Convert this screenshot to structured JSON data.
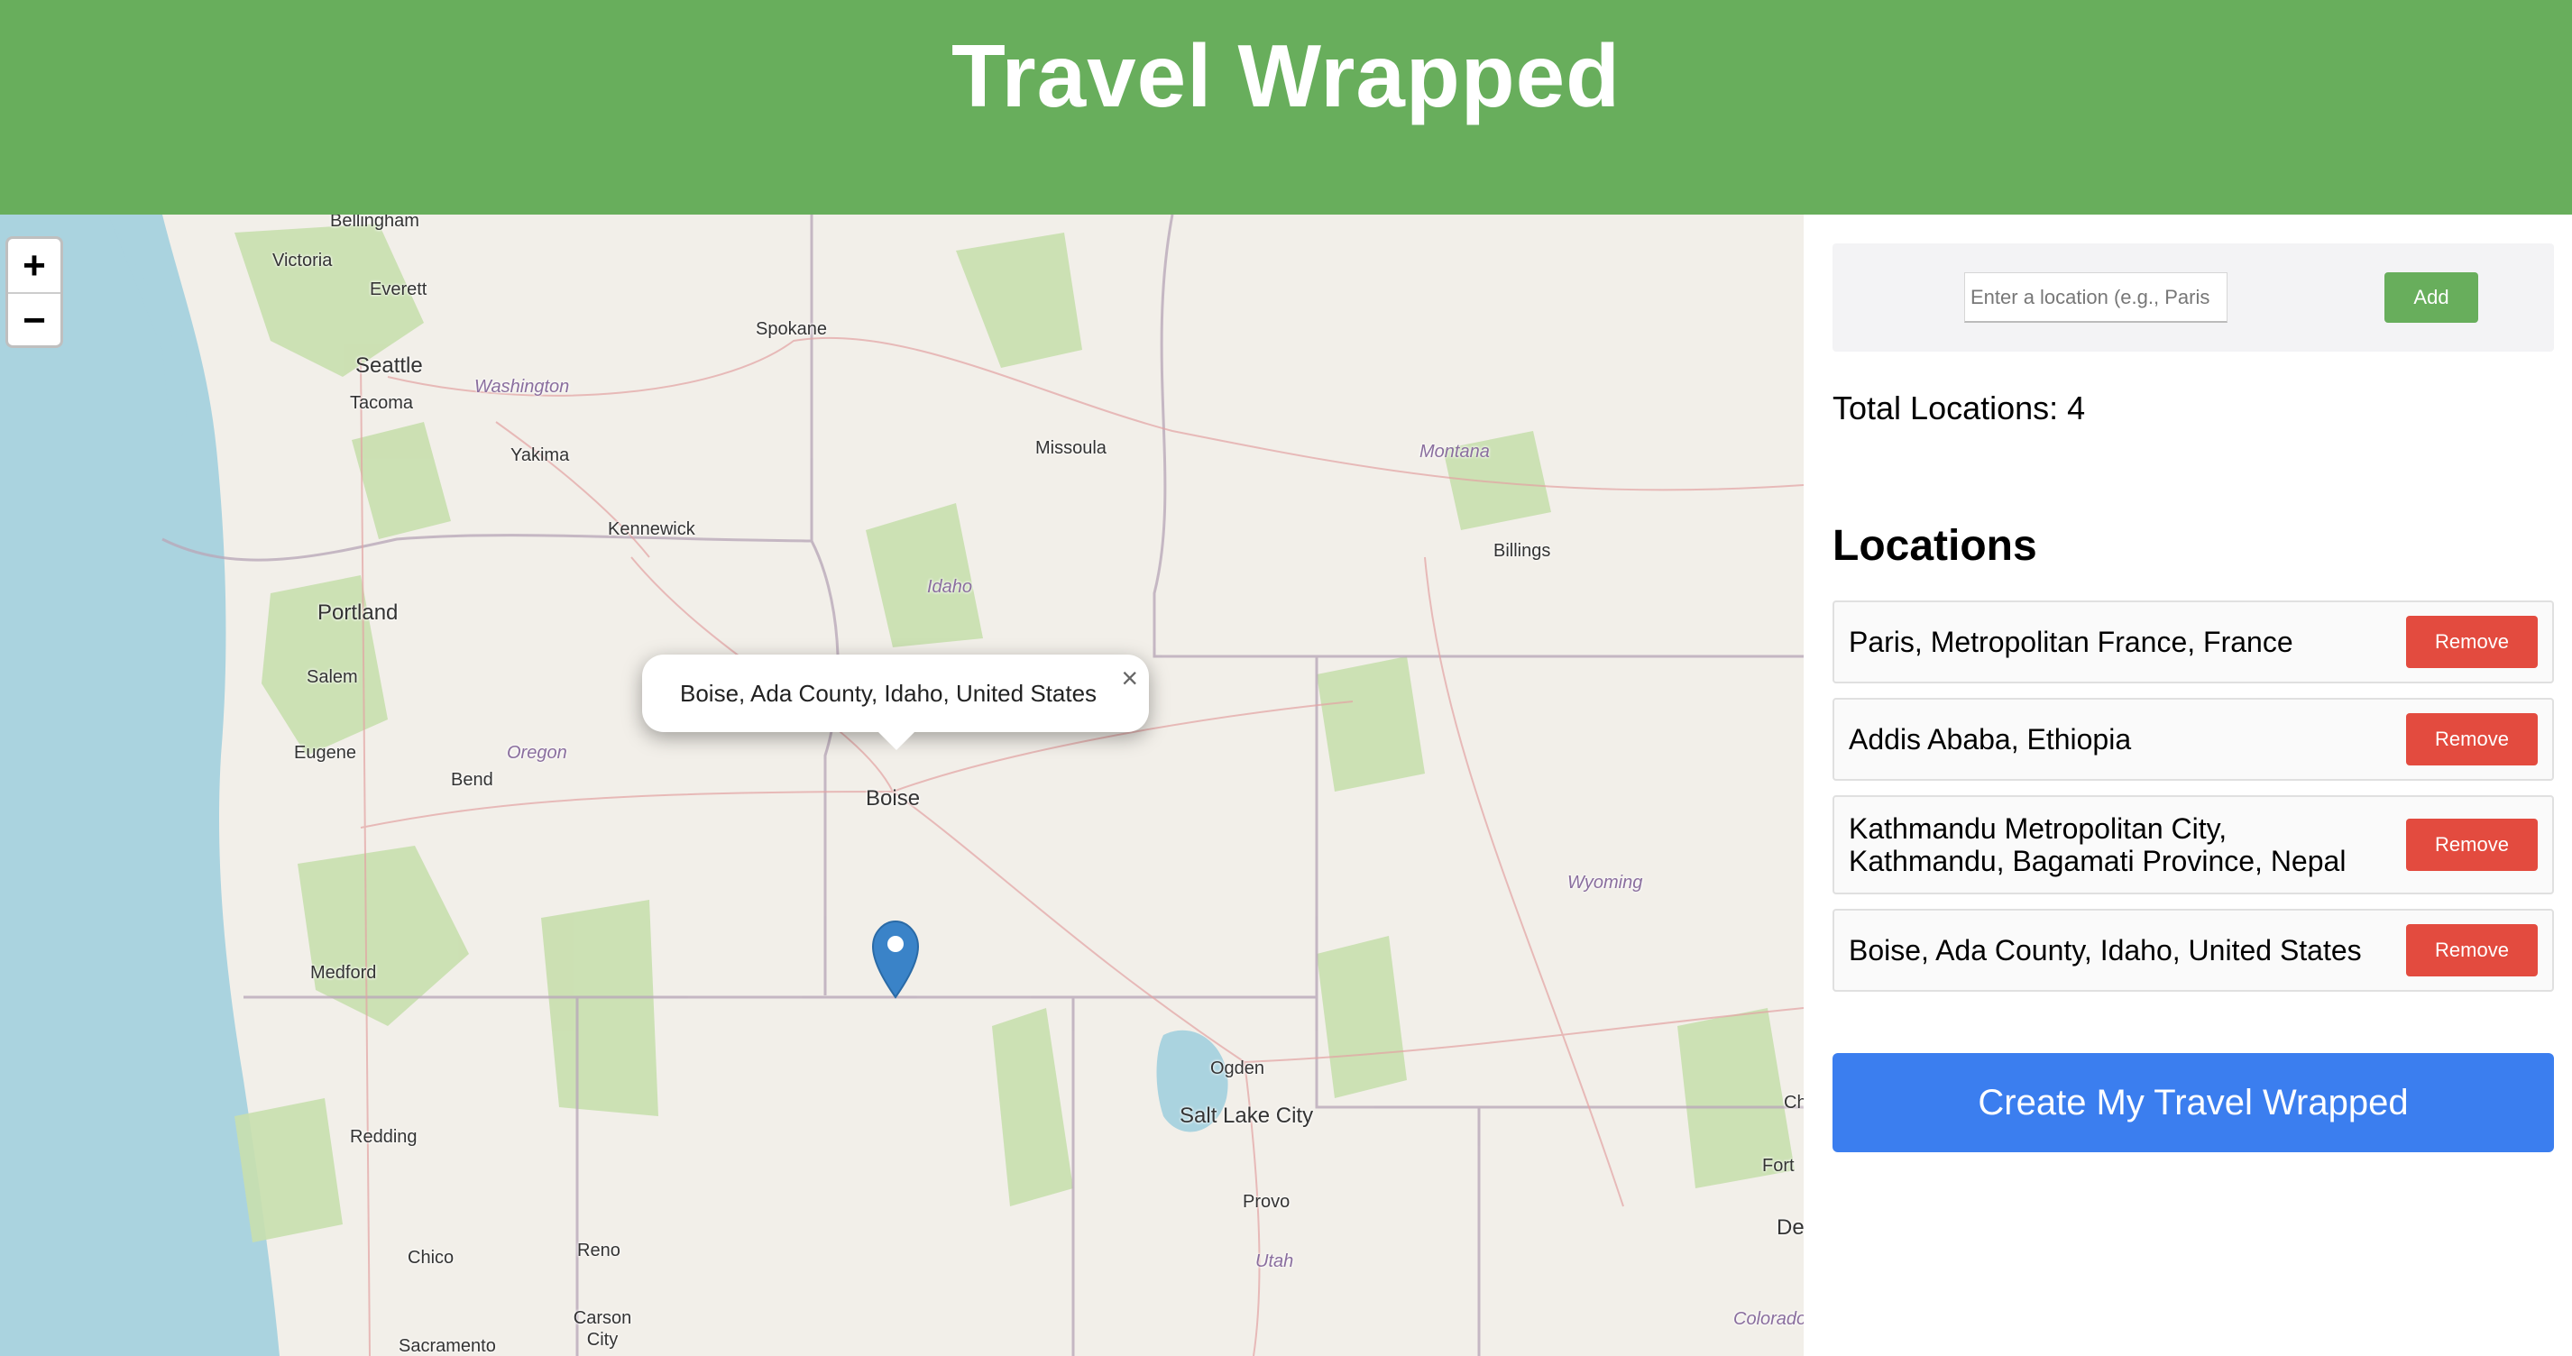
{
  "header": {
    "title": "Travel Wrapped"
  },
  "map": {
    "zoom_in": "+",
    "zoom_out": "−",
    "popup": {
      "text": "Boise, Ada County, Idaho, United States",
      "close": "×"
    },
    "labels": {
      "bellingham": "Bellingham",
      "victoria": "Victoria",
      "everett": "Everett",
      "seattle": "Seattle",
      "washington": "Washington",
      "tacoma": "Tacoma",
      "spokane": "Spokane",
      "yakima": "Yakima",
      "missoula": "Missoula",
      "montana": "Montana",
      "kennewick": "Kennewick",
      "idaho": "Idaho",
      "billings": "Billings",
      "portland": "Portland",
      "salem": "Salem",
      "eugene": "Eugene",
      "oregon": "Oregon",
      "bend": "Bend",
      "boise": "Boise",
      "wyoming": "Wyoming",
      "medford": "Medford",
      "ogden": "Ogden",
      "salt_lake_city": "Salt Lake City",
      "redding": "Redding",
      "provo": "Provo",
      "utah": "Utah",
      "chico": "Chico",
      "reno": "Reno",
      "carson_city": "Carson City",
      "sacramento": "Sacramento",
      "fort": "Fort",
      "de": "De",
      "ch": "Ch",
      "colorado": "Colorado"
    }
  },
  "panel": {
    "input_placeholder": "Enter a location (e.g., Paris",
    "add_label": "Add",
    "total_label": "Total Locations: 4",
    "locations_title": "Locations",
    "remove_label": "Remove",
    "locations": [
      "Paris, Metropolitan France, France",
      "Addis Ababa, Ethiopia",
      "Kathmandu Metropolitan City, Kathmandu, Bagamati Province, Nepal",
      "Boise, Ada County, Idaho, United States"
    ],
    "create_label": "Create My Travel Wrapped"
  },
  "colors": {
    "header": "#68ae5c",
    "add_button": "#68ae5c",
    "remove_button": "#e34b3f",
    "create_button": "#3b7eef",
    "marker": "#3a83c8"
  }
}
